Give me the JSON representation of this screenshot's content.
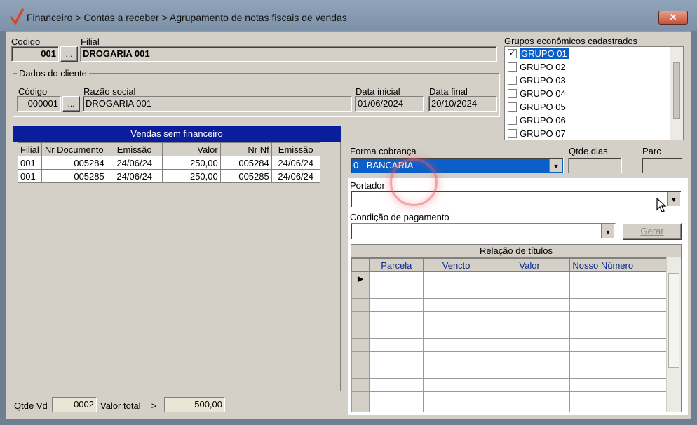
{
  "window": {
    "title": "Financeiro > Contas a receber > Agrupamento de notas fiscais de vendas",
    "close_label": "✕"
  },
  "header": {
    "codigo_label": "Codigo",
    "codigo_value": "001",
    "lookup_label": "...",
    "filial_label": "Filial",
    "filial_value": "DROGARIA 001"
  },
  "cliente": {
    "legend": "Dados do cliente",
    "codigo_label": "Código",
    "codigo_value": "000001",
    "lookup_label": "...",
    "razao_label": "Razão social",
    "razao_value": "DROGARIA 001",
    "data_inicial_label": "Data inicial",
    "data_inicial_value": "01/06/2024",
    "data_final_label": "Data final",
    "data_final_value": "20/10/2024"
  },
  "grupos": {
    "label": "Grupos econômicos cadastrados",
    "items": [
      {
        "label": "GRUPO 01",
        "checked": true
      },
      {
        "label": "GRUPO 02",
        "checked": false
      },
      {
        "label": "GRUPO 03",
        "checked": false
      },
      {
        "label": "GRUPO 04",
        "checked": false
      },
      {
        "label": "GRUPO 05",
        "checked": false
      },
      {
        "label": "GRUPO 06",
        "checked": false
      },
      {
        "label": "GRUPO 07",
        "checked": false
      }
    ]
  },
  "vendas": {
    "title": "Vendas sem financeiro",
    "columns": [
      "Filial",
      "Nr Documento",
      "Emissão",
      "Valor",
      "Nr Nf",
      "Emissão"
    ],
    "rows": [
      [
        "001",
        "005284",
        "24/06/24",
        "250,00",
        "005284",
        "24/06/24"
      ],
      [
        "001",
        "005285",
        "24/06/24",
        "250,00",
        "005285",
        "24/06/24"
      ]
    ],
    "qtde_label": "Qtde Vd",
    "qtde_value": "0002",
    "total_label": "Valor total==>",
    "total_value": "500,00"
  },
  "cobranca": {
    "forma_label": "Forma cobrança",
    "forma_value": "0 - BANCARIA",
    "qtde_dias_label": "Qtde dias",
    "parc_label": "Parc",
    "portador_label": "Portador",
    "portador_value": "",
    "condicao_label": "Condição de pagamento",
    "condicao_value": "",
    "gerar_label": "Gerar"
  },
  "relacao": {
    "title": "Relação de títulos",
    "columns": [
      "Parcela",
      "Vencto",
      "Valor",
      "Nosso Número"
    ],
    "row_count": 11,
    "current_row_marker": "▶"
  },
  "icons": {
    "logo": "checkmark-logo-icon",
    "dropdown": "chevron-down-icon",
    "cursor": "mouse-pointer-icon"
  },
  "colors": {
    "selection_blue": "#0a5fc9",
    "header_navy": "#0a1e9c",
    "title_blue": "#8fa3b9"
  }
}
